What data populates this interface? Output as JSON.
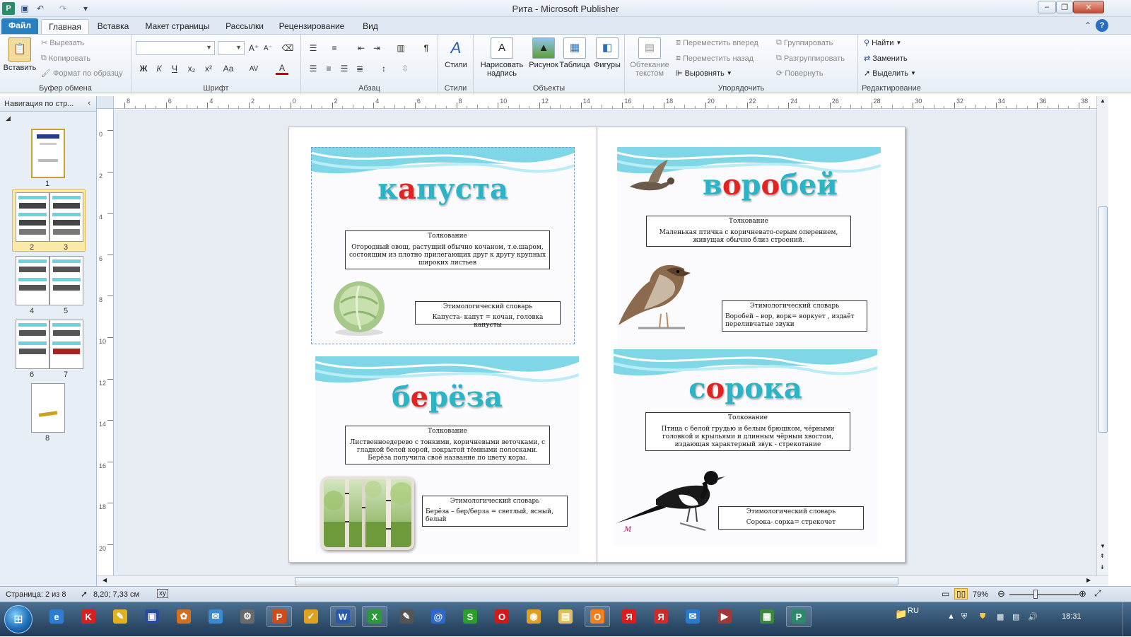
{
  "app": {
    "doc_name": "Рита",
    "app_name": "Microsoft Publisher",
    "title_sep": " - "
  },
  "tabs": [
    {
      "label": "Файл"
    },
    {
      "label": "Главная"
    },
    {
      "label": "Вставка"
    },
    {
      "label": "Макет страницы"
    },
    {
      "label": "Рассылки"
    },
    {
      "label": "Рецензирование"
    },
    {
      "label": "Вид"
    }
  ],
  "ribbon": {
    "clipboard": {
      "paste": "Вставить",
      "cut": "Вырезать",
      "copy": "Копировать",
      "format_painter": "Формат по образцу",
      "label": "Буфер обмена"
    },
    "font": {
      "bold": "Ж",
      "italic": "К",
      "underline": "Ч",
      "subscript": "x₂",
      "superscript": "x²",
      "case": "Аа",
      "spacing": "AV",
      "color": "А",
      "label": "Шрифт"
    },
    "paragraph": {
      "pilcrow": "¶",
      "label": "Абзац"
    },
    "styles": {
      "button": "Стили",
      "label": "Стили"
    },
    "objects": {
      "textbox": "Нарисовать надпись",
      "picture": "Рисунок",
      "table": "Таблица",
      "shapes": "Фигуры",
      "label": "Объекты"
    },
    "arrange": {
      "wrap": "Обтекание текстом",
      "forward": "Переместить вперед",
      "backward": "Переместить назад",
      "align": "Выровнять",
      "group": "Группировать",
      "ungroup": "Разгруппировать",
      "rotate": "Повернуть",
      "label": "Упорядочить"
    },
    "editing": {
      "find": "Найти",
      "replace": "Заменить",
      "select": "Выделить",
      "label": "Редактирование"
    }
  },
  "nav": {
    "title": "Навигация по стр...",
    "pages": [
      "1",
      "2",
      "3",
      "4",
      "5",
      "6",
      "7",
      "8"
    ]
  },
  "ruler": {
    "h": [
      "8",
      "6",
      "4",
      "2",
      "0",
      "2",
      "4",
      "6",
      "8",
      "10",
      "12",
      "14",
      "16",
      "18",
      "20",
      "22",
      "24",
      "26",
      "28",
      "30",
      "32",
      "34",
      "36",
      "38"
    ],
    "v": [
      "0",
      "2",
      "4",
      "6",
      "8",
      "10",
      "12",
      "14",
      "16",
      "18",
      "20"
    ]
  },
  "cards": [
    {
      "word": [
        "к",
        "а",
        "пуста"
      ],
      "def_title": "Толкование",
      "def_text": "Огородный овощ, растущий обычно кочаном, т.е.шаром, состоящим из плотно прилегающих друг к другу крупных широких листьев",
      "etym_title": "Этимологический словарь",
      "etym_text": "Капуста- капут = кочан, головка капусты",
      "picture": "cabbage"
    },
    {
      "word": [
        "в",
        "о",
        "р",
        "о",
        "бей"
      ],
      "def_title": "Толкование",
      "def_text": "Маленькая птичка с коричневато-серым оперением, живущая обычно близ строений.",
      "etym_title": "Этимологический словарь",
      "etym_text": "Воробей – вор, ворк= воркует , издаёт переливчатые звуки",
      "picture": "sparrow"
    },
    {
      "word": [
        "б",
        "е",
        "рёза"
      ],
      "def_title": "Толкование",
      "def_text": "Лиственноедерево с тонкими, коричневыми веточками, с гладкой белой корой, покрытой тёмными полосками. Берёза получила своё название по цвету коры.",
      "etym_title": "Этимологический словарь",
      "etym_text": "Берёза – бер/берза = светлый, ясный, белый",
      "picture": "birch"
    },
    {
      "word": [
        "с",
        "о",
        "рока"
      ],
      "def_title": "Толкование",
      "def_text": "Птица с белой грудью и белым брюшком, чёрными головкой и крыльями и длинным чёрным хвостом, издающая характерный звук - стрекотание",
      "etym_title": "Этимологический словарь",
      "etym_text": "Сорока- сорка= стрекочет",
      "picture": "magpie"
    }
  ],
  "status": {
    "page": "Страница: 2 из 8",
    "coords": "8,20; 7,33 см",
    "zoom": "79%"
  },
  "taskbar": {
    "apps": [
      "ie-icon",
      "kaspersky-icon",
      "tool-icon",
      "save-icon",
      "paint-icon",
      "messenger-icon",
      "network-icon",
      "publisher-task-icon",
      "notes-icon",
      "word-icon",
      "excel-icon",
      "scanner-icon",
      "mail-icon",
      "skype-icon",
      "opera-icon",
      "chrome-icon",
      "explorer-icon",
      "ok-icon",
      "yandex-icon",
      "yandex-browser-icon",
      "mail-agent-icon",
      "video-icon",
      "spreadsheet-icon",
      "publisher-active-icon"
    ],
    "lang": "RU",
    "time": "18:31"
  }
}
